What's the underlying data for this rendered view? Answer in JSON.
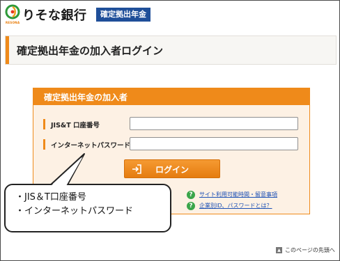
{
  "header": {
    "bank_name": "りそな銀行",
    "logo_subtext": "RESONA",
    "badge": "確定拠出年金"
  },
  "title": {
    "text": "確定拠出年金の加入者ログイン"
  },
  "panel": {
    "title": "確定拠出年金の加入者",
    "fields": [
      {
        "label": "JIS&T 口座番号",
        "value": "",
        "placeholder": ""
      },
      {
        "label": "インターネットパスワード",
        "value": "",
        "placeholder": ""
      }
    ],
    "login_button": "ログイン",
    "links": [
      {
        "icon": "?",
        "text": "サイト利用可能時間・留意事項"
      },
      {
        "icon": "?",
        "text": "企業別ID、パスワードとは？"
      }
    ]
  },
  "callout": {
    "lines": [
      "・JIS＆T口座番号",
      "・インターネットパスワード"
    ]
  },
  "footer": {
    "page_top": "このページの先頭へ"
  },
  "colors": {
    "accent_orange": "#ef8a1a",
    "brand_blue": "#1f4f99",
    "panel_bg": "#fdf1e4",
    "help_green": "#3aa54a",
    "link_blue": "#1a4fb5"
  },
  "icons": {
    "logo": "resona-logo-icon",
    "login": "login-arrow-icon",
    "help": "question-circle-icon",
    "page_top": "page-top-icon"
  }
}
